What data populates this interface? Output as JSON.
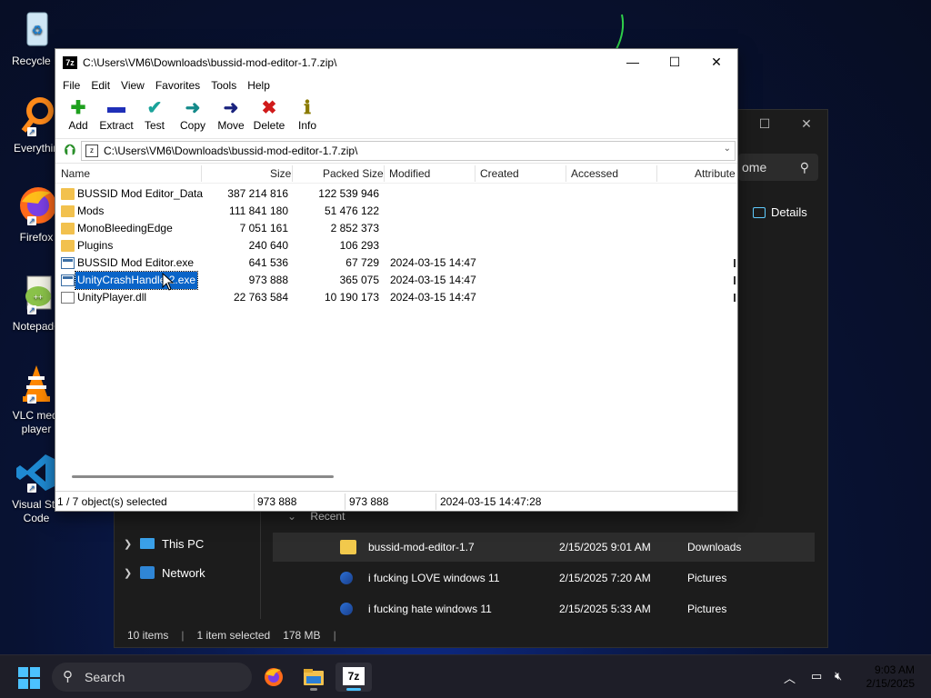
{
  "desktop": {
    "icons": [
      {
        "label": "Recycle B",
        "icon": "recycle-bin-icon"
      },
      {
        "label": "Everythin",
        "icon": "everything-search-icon"
      },
      {
        "label": "Firefox",
        "icon": "firefox-icon"
      },
      {
        "label": "Notepad+",
        "icon": "notepad-plus-plus-icon"
      },
      {
        "label": "VLC medi\nplayer",
        "icon": "vlc-icon"
      },
      {
        "label": "Visual Stu\nCode",
        "icon": "vscode-icon"
      }
    ]
  },
  "explorer": {
    "search_text": "ome",
    "details_label": "Details",
    "nav": [
      {
        "label": "This PC",
        "icon": "this-pc-icon"
      },
      {
        "label": "Network",
        "icon": "network-icon"
      }
    ],
    "recent_label": "Recent",
    "recent": [
      {
        "name": "bussid-mod-editor-1.7",
        "date": "2/15/2025 9:01 AM",
        "location": "Downloads",
        "icon": "zip-folder-icon"
      },
      {
        "name": "i fucking LOVE windows 11",
        "date": "2/15/2025 7:20 AM",
        "location": "Pictures",
        "icon": "image-file-icon"
      },
      {
        "name": "i fucking hate windows 11",
        "date": "2/15/2025 5:33 AM",
        "location": "Pictures",
        "icon": "image-file-icon"
      }
    ],
    "status": {
      "items": "10 items",
      "selected": "1 item selected",
      "size": "178 MB"
    }
  },
  "sevenzip": {
    "title": "C:\\Users\\VM6\\Downloads\\bussid-mod-editor-1.7.zip\\",
    "logo_text": "7z",
    "menu": [
      "File",
      "Edit",
      "View",
      "Favorites",
      "Tools",
      "Help"
    ],
    "toolbar": [
      {
        "label": "Add",
        "icon": "add-icon",
        "glyph": "✚",
        "color": "#1ea01e"
      },
      {
        "label": "Extract",
        "icon": "extract-icon",
        "glyph": "▬",
        "color": "#1f2fb8"
      },
      {
        "label": "Test",
        "icon": "test-icon",
        "glyph": "✔",
        "color": "#1aa39a"
      },
      {
        "label": "Copy",
        "icon": "copy-icon",
        "glyph": "➜",
        "color": "#148a8a"
      },
      {
        "label": "Move",
        "icon": "move-icon",
        "glyph": "➜",
        "color": "#1a237e"
      },
      {
        "label": "Delete",
        "icon": "delete-icon",
        "glyph": "✖",
        "color": "#d01a1a"
      },
      {
        "label": "Info",
        "icon": "info-icon",
        "glyph": "ℹ",
        "color": "#8a7a00"
      }
    ],
    "address": "C:\\Users\\VM6\\Downloads\\bussid-mod-editor-1.7.zip\\",
    "columns": {
      "name": "Name",
      "size": "Size",
      "packed": "Packed Size",
      "modified": "Modified",
      "created": "Created",
      "accessed": "Accessed",
      "attributes": "Attribute"
    },
    "files": [
      {
        "name": "BUSSID Mod Editor_Data",
        "size": "387 214 816",
        "packed": "122 539 946",
        "modified": "",
        "type": "folder"
      },
      {
        "name": "Mods",
        "size": "111 841 180",
        "packed": "51 476 122",
        "modified": "",
        "type": "folder"
      },
      {
        "name": "MonoBleedingEdge",
        "size": "7 051 161",
        "packed": "2 852 373",
        "modified": "",
        "type": "folder"
      },
      {
        "name": "Plugins",
        "size": "240 640",
        "packed": "106 293",
        "modified": "",
        "type": "folder"
      },
      {
        "name": "BUSSID Mod Editor.exe",
        "size": "641 536",
        "packed": "67 729",
        "modified": "2024-03-15 14:47",
        "type": "exe"
      },
      {
        "name": "UnityCrashHandle  2.exe",
        "size": "973 888",
        "packed": "365 075",
        "modified": "2024-03-15 14:47",
        "type": "exe",
        "selected": true
      },
      {
        "name": "UnityPlayer.dll",
        "size": "22 763 584",
        "packed": "10 190 173",
        "modified": "2024-03-15 14:47",
        "type": "dll"
      }
    ],
    "status": {
      "selection": "1 / 7 object(s) selected",
      "size": "973 888",
      "packed": "973 888",
      "modified": "2024-03-15 14:47:28"
    }
  },
  "taskbar": {
    "search_placeholder": "Search",
    "time": "9:03 AM",
    "date": "2/15/2025"
  }
}
